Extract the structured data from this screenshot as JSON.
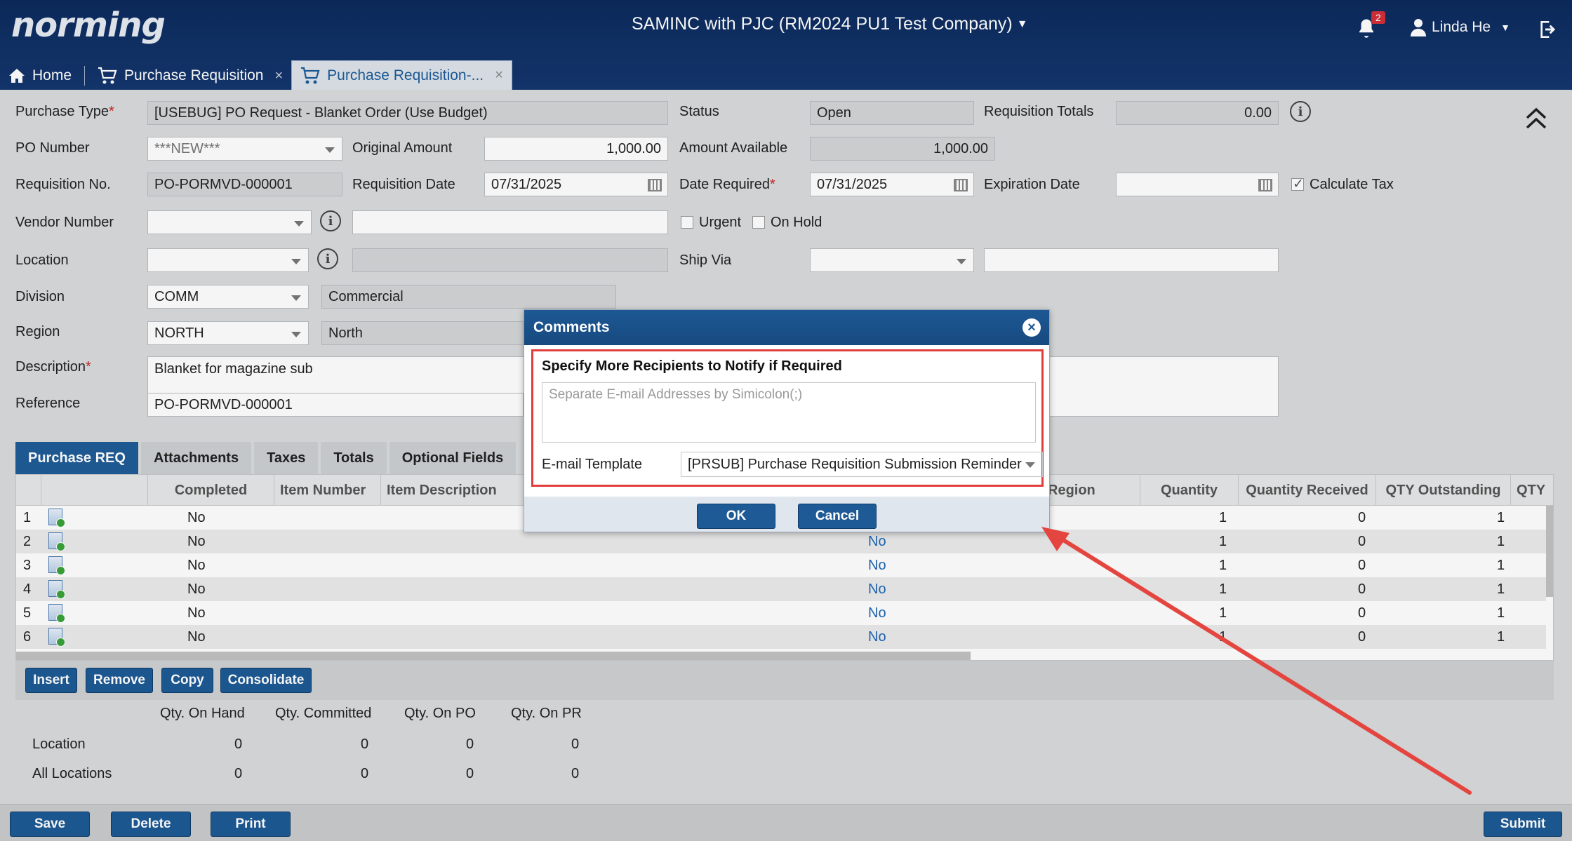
{
  "header": {
    "logo": "norming",
    "company": "SAMINC with PJC (RM2024 PU1 Test Company)",
    "notification_count": "2",
    "user_name": "Linda He"
  },
  "tabs": [
    {
      "label": "Home"
    },
    {
      "label": "Purchase Requisition"
    },
    {
      "label": "Purchase Requisition-..."
    }
  ],
  "form": {
    "purchase_type_label": "Purchase Type",
    "purchase_type": "[USEBUG] PO Request - Blanket Order (Use Budget)",
    "status_label": "Status",
    "status": "Open",
    "requisition_totals_label": "Requisition Totals",
    "requisition_totals": "0.00",
    "po_number_label": "PO Number",
    "po_number": "***NEW***",
    "original_amount_label": "Original Amount",
    "original_amount": "1,000.00",
    "amount_available_label": "Amount Available",
    "amount_available": "1,000.00",
    "requisition_no_label": "Requisition No.",
    "requisition_no": "PO-PORMVD-000001",
    "requisition_date_label": "Requisition Date",
    "requisition_date": "07/31/2025",
    "date_required_label": "Date Required",
    "date_required": "07/31/2025",
    "expiration_date_label": "Expiration Date",
    "expiration_date": "",
    "calculate_tax_label": "Calculate Tax",
    "vendor_number_label": "Vendor Number",
    "urgent_label": "Urgent",
    "on_hold_label": "On Hold",
    "location_label": "Location",
    "ship_via_label": "Ship Via",
    "division_label": "Division",
    "division": "COMM",
    "division_desc": "Commercial",
    "region_label": "Region",
    "region": "NORTH",
    "region_desc": "North",
    "description_label": "Description",
    "description": "Blanket for magazine sub",
    "reference_label": "Reference",
    "reference": "PO-PORMVD-000001"
  },
  "detail_tabs": [
    "Purchase REQ",
    "Attachments",
    "Taxes",
    "Totals",
    "Optional Fields"
  ],
  "grid": {
    "columns": [
      "Completed",
      "Item Number",
      "Item Description",
      "Region",
      "Quantity",
      "Quantity Received",
      "QTY Outstanding",
      "QTY"
    ],
    "rows": [
      {
        "n": "1",
        "completed": "No",
        "mid": "",
        "quantity": "1",
        "received": "0",
        "outstanding": "1"
      },
      {
        "n": "2",
        "completed": "No",
        "mid": "No",
        "quantity": "1",
        "received": "0",
        "outstanding": "1"
      },
      {
        "n": "3",
        "completed": "No",
        "mid": "No",
        "quantity": "1",
        "received": "0",
        "outstanding": "1"
      },
      {
        "n": "4",
        "completed": "No",
        "mid": "No",
        "quantity": "1",
        "received": "0",
        "outstanding": "1"
      },
      {
        "n": "5",
        "completed": "No",
        "mid": "No",
        "quantity": "1",
        "received": "0",
        "outstanding": "1"
      },
      {
        "n": "6",
        "completed": "No",
        "mid": "No",
        "quantity": "1",
        "received": "0",
        "outstanding": "1"
      }
    ]
  },
  "grid_buttons": {
    "insert": "Insert",
    "remove": "Remove",
    "copy": "Copy",
    "consolidate": "Consolidate"
  },
  "qty_summary": {
    "headers": [
      "Qty. On Hand",
      "Qty. Committed",
      "Qty. On PO",
      "Qty. On PR"
    ],
    "rows": [
      {
        "label": "Location",
        "values": [
          "0",
          "0",
          "0",
          "0"
        ]
      },
      {
        "label": "All Locations",
        "values": [
          "0",
          "0",
          "0",
          "0"
        ]
      }
    ]
  },
  "footer": {
    "save": "Save",
    "delete": "Delete",
    "print": "Print",
    "submit": "Submit"
  },
  "modal": {
    "title": "Comments",
    "section_title": "Specify More Recipients to Notify if Required",
    "email_placeholder": "Separate E-mail Addresses by Simicolon(;)",
    "template_label": "E-mail Template",
    "template_value": "[PRSUB] Purchase Requisition Submission Reminder",
    "ok": "OK",
    "cancel": "Cancel"
  },
  "colors": {
    "header_bg": "#14376f",
    "accent": "#1e5a95",
    "highlight": "#e23d3d",
    "link": "#1f66b3"
  }
}
